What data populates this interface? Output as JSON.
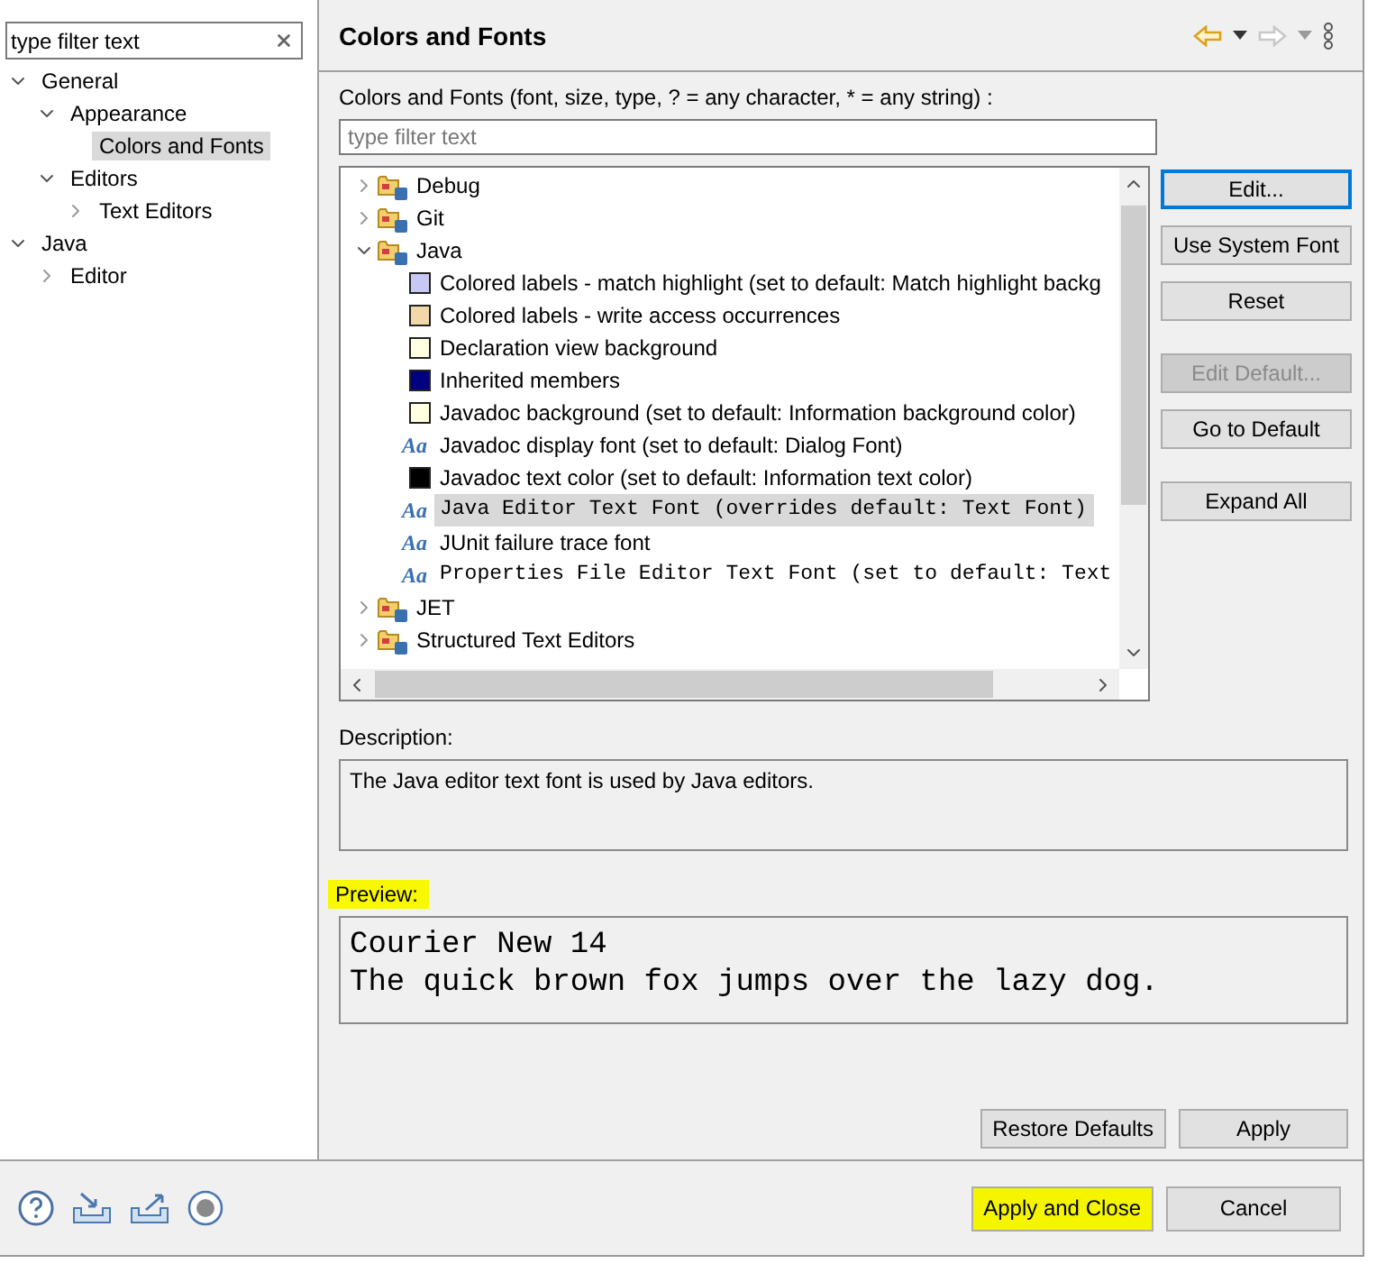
{
  "sidebar": {
    "filter": {
      "value": "type filter text"
    },
    "items": [
      {
        "label": "General",
        "expanded": true,
        "selected": false,
        "children": [
          {
            "label": "Appearance",
            "expanded": true,
            "selected": false,
            "children": [
              {
                "label": "Colors and Fonts",
                "selected": true
              }
            ]
          },
          {
            "label": "Editors",
            "expanded": true,
            "selected": false,
            "children": [
              {
                "label": "Text Editors",
                "expanded": false,
                "selected": false
              }
            ]
          }
        ]
      },
      {
        "label": "Java",
        "expanded": true,
        "selected": false,
        "children": [
          {
            "label": "Editor",
            "expanded": false,
            "selected": false
          }
        ]
      }
    ]
  },
  "page": {
    "title": "Colors and Fonts",
    "toolbar": [
      {
        "kind": "back",
        "disabled": false
      },
      {
        "kind": "menu",
        "disabled": false
      },
      {
        "kind": "forward",
        "disabled": true
      },
      {
        "kind": "menu",
        "disabled": true
      },
      {
        "kind": "more",
        "disabled": false
      }
    ],
    "filter_label": "Colors and Fonts (font, size, type, ? = any character, * = any string) :",
    "filter": {
      "placeholder": "type filter text"
    },
    "tree": [
      {
        "label": "Debug",
        "kind": "category",
        "expanded": false,
        "selected": false
      },
      {
        "label": "Git",
        "kind": "category",
        "expanded": false,
        "selected": false
      },
      {
        "label": "Java",
        "kind": "category",
        "expanded": true,
        "selected": false,
        "children": [
          {
            "label": "Colored labels - match highlight (set to default: Match highlight backg",
            "kind": "color",
            "color": "#c8c8f4",
            "selected": false
          },
          {
            "label": "Colored labels - write access occurrences",
            "kind": "color",
            "color": "#f2d8a8",
            "selected": false
          },
          {
            "label": "Declaration view background",
            "kind": "color",
            "color": "#ffffe1",
            "selected": false
          },
          {
            "label": "Inherited members",
            "kind": "color",
            "color": "#000080",
            "selected": false
          },
          {
            "label": "Javadoc background (set to default: Information background color)",
            "kind": "color",
            "color": "#ffffe1",
            "selected": false
          },
          {
            "label": "Javadoc display font (set to default: Dialog Font)",
            "kind": "font",
            "glyph": "Aa",
            "monospace": false,
            "selected": false
          },
          {
            "label": "Javadoc text color (set to default: Information text color)",
            "kind": "color",
            "color": "#000000",
            "selected": false
          },
          {
            "label": "Java Editor Text Font (overrides default: Text Font)",
            "kind": "font",
            "glyph": "Aa",
            "monospace": true,
            "selected": true
          },
          {
            "label": "JUnit failure trace font",
            "kind": "font",
            "glyph": "Aa",
            "monospace": false,
            "selected": false
          },
          {
            "label": "Properties File Editor Text Font (set to default: Text",
            "kind": "font",
            "glyph": "Aa",
            "monospace": true,
            "selected": false
          }
        ]
      },
      {
        "label": "JET",
        "kind": "category",
        "expanded": false,
        "selected": false
      },
      {
        "label": "Structured Text Editors",
        "kind": "category",
        "expanded": false,
        "selected": false
      }
    ],
    "button_groups": [
      [
        {
          "label": "Edit...",
          "disabled": false,
          "focused": true
        },
        {
          "label": "Use System Font",
          "disabled": false,
          "focused": false
        },
        {
          "label": "Reset",
          "disabled": false,
          "focused": false
        }
      ],
      [
        {
          "label": "Edit Default...",
          "disabled": true,
          "focused": false
        },
        {
          "label": "Go to Default",
          "disabled": false,
          "focused": false
        }
      ],
      [
        {
          "label": "Expand All",
          "disabled": false,
          "focused": false
        }
      ]
    ],
    "description_label": "Description:",
    "description": "The Java editor text font is used by Java editors.",
    "preview_label": {
      "text": "Preview:",
      "highlighted": true
    },
    "preview": [
      "Courier New 14",
      "The quick brown fox jumps over the lazy dog."
    ],
    "actions": [
      {
        "label": "Restore Defaults"
      },
      {
        "label": "Apply"
      }
    ]
  },
  "footer": {
    "icons": [
      {
        "kind": "help"
      },
      {
        "kind": "import"
      },
      {
        "kind": "export"
      },
      {
        "kind": "record"
      }
    ],
    "buttons": [
      {
        "label": "Apply and Close",
        "highlighted": true
      },
      {
        "label": "Cancel",
        "highlighted": false
      }
    ]
  }
}
